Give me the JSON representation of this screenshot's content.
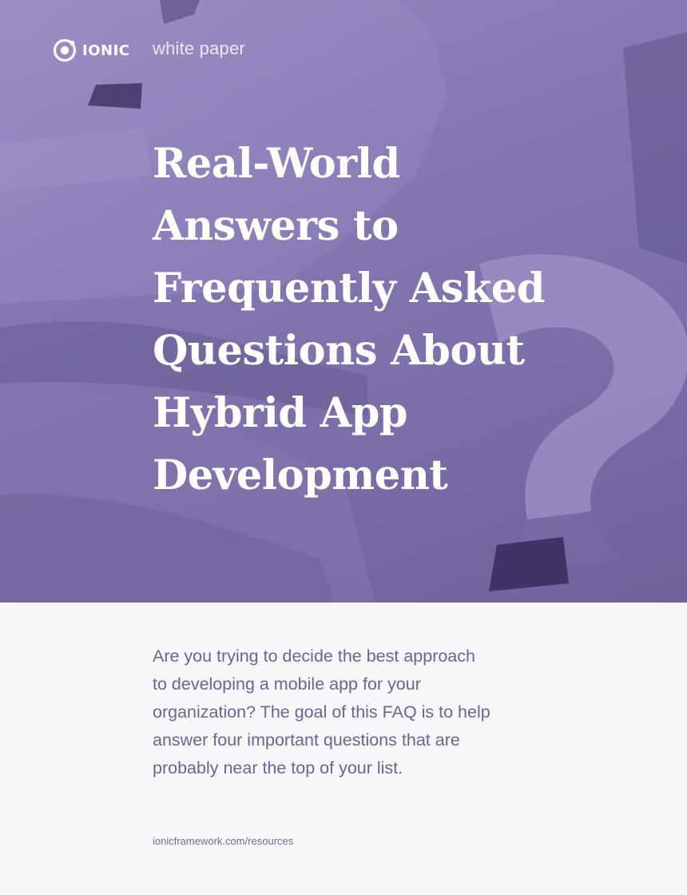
{
  "header": {
    "logo_word": "IONIC",
    "doc_type": "white paper"
  },
  "hero": {
    "title_lines": [
      "Real-World",
      "Answers to",
      "Frequently Asked",
      "Questions About",
      "Hybrid App",
      "Development"
    ],
    "background_icon": "paper-question-marks-image"
  },
  "intro": {
    "lines": [
      "Are you trying to decide the best approach",
      "to developing a mobile app for your",
      "organization? The goal of this FAQ is to help",
      "answer four important questions that are",
      "probably near the top of your list."
    ]
  },
  "footer": {
    "url": "ionicframework.com/resources"
  },
  "colors": {
    "hero_purple": "#8678b1",
    "text_purple": "#6d6493",
    "page_background": "#f6f7f9"
  }
}
